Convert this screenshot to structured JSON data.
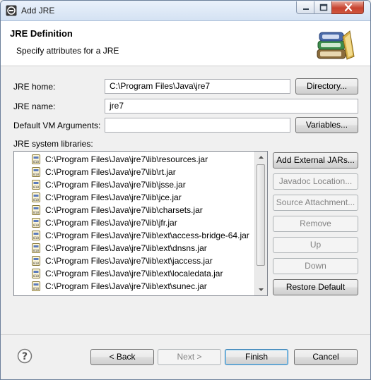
{
  "window": {
    "title": "Add JRE"
  },
  "header": {
    "title": "JRE Definition",
    "subtitle": "Specify attributes for a JRE"
  },
  "form": {
    "jre_home_label": "JRE home:",
    "jre_home_value": "C:\\Program Files\\Java\\jre7",
    "directory_button": "Directory...",
    "jre_name_label": "JRE name:",
    "jre_name_value": "jre7",
    "vm_args_label": "Default VM Arguments:",
    "vm_args_value": "",
    "variables_button": "Variables..."
  },
  "libraries": {
    "label": "JRE system libraries:",
    "items": [
      "C:\\Program Files\\Java\\jre7\\lib\\resources.jar",
      "C:\\Program Files\\Java\\jre7\\lib\\rt.jar",
      "C:\\Program Files\\Java\\jre7\\lib\\jsse.jar",
      "C:\\Program Files\\Java\\jre7\\lib\\jce.jar",
      "C:\\Program Files\\Java\\jre7\\lib\\charsets.jar",
      "C:\\Program Files\\Java\\jre7\\lib\\jfr.jar",
      "C:\\Program Files\\Java\\jre7\\lib\\ext\\access-bridge-64.jar",
      "C:\\Program Files\\Java\\jre7\\lib\\ext\\dnsns.jar",
      "C:\\Program Files\\Java\\jre7\\lib\\ext\\jaccess.jar",
      "C:\\Program Files\\Java\\jre7\\lib\\ext\\localedata.jar",
      "C:\\Program Files\\Java\\jre7\\lib\\ext\\sunec.jar"
    ],
    "buttons": {
      "add_external_jars": "Add External JARs...",
      "javadoc_location": "Javadoc Location...",
      "source_attachment": "Source Attachment...",
      "remove": "Remove",
      "up": "Up",
      "down": "Down",
      "restore_default": "Restore Default"
    }
  },
  "footer": {
    "back": "< Back",
    "next": "Next >",
    "finish": "Finish",
    "cancel": "Cancel"
  },
  "colors": {
    "title_gradient_top": "#eaf1fb",
    "close_button": "#c7432f",
    "default_button_border": "#3c7fb1"
  }
}
